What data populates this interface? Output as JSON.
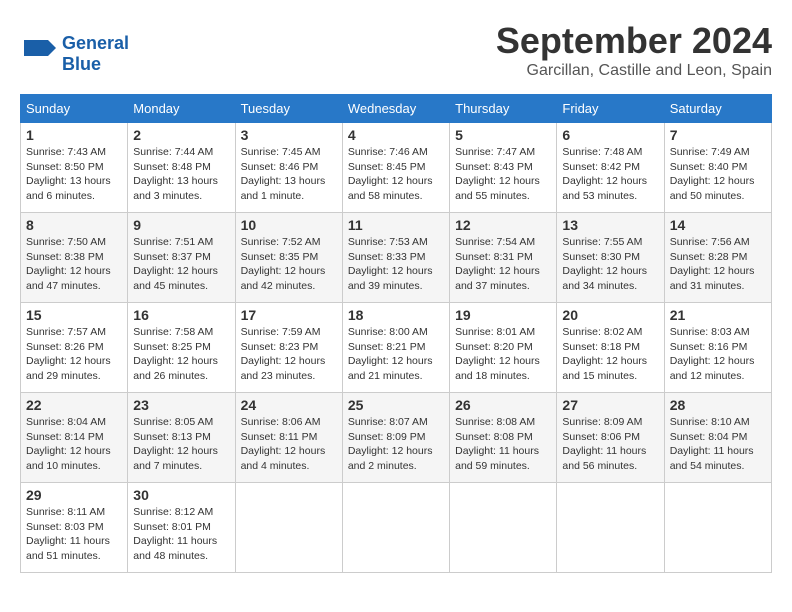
{
  "logo": {
    "line1": "General",
    "line2": "Blue"
  },
  "title": "September 2024",
  "location": "Garcillan, Castille and Leon, Spain",
  "headers": [
    "Sunday",
    "Monday",
    "Tuesday",
    "Wednesday",
    "Thursday",
    "Friday",
    "Saturday"
  ],
  "weeks": [
    [
      {
        "day": "1",
        "info": "Sunrise: 7:43 AM\nSunset: 8:50 PM\nDaylight: 13 hours\nand 6 minutes."
      },
      {
        "day": "2",
        "info": "Sunrise: 7:44 AM\nSunset: 8:48 PM\nDaylight: 13 hours\nand 3 minutes."
      },
      {
        "day": "3",
        "info": "Sunrise: 7:45 AM\nSunset: 8:46 PM\nDaylight: 13 hours\nand 1 minute."
      },
      {
        "day": "4",
        "info": "Sunrise: 7:46 AM\nSunset: 8:45 PM\nDaylight: 12 hours\nand 58 minutes."
      },
      {
        "day": "5",
        "info": "Sunrise: 7:47 AM\nSunset: 8:43 PM\nDaylight: 12 hours\nand 55 minutes."
      },
      {
        "day": "6",
        "info": "Sunrise: 7:48 AM\nSunset: 8:42 PM\nDaylight: 12 hours\nand 53 minutes."
      },
      {
        "day": "7",
        "info": "Sunrise: 7:49 AM\nSunset: 8:40 PM\nDaylight: 12 hours\nand 50 minutes."
      }
    ],
    [
      {
        "day": "8",
        "info": "Sunrise: 7:50 AM\nSunset: 8:38 PM\nDaylight: 12 hours\nand 47 minutes."
      },
      {
        "day": "9",
        "info": "Sunrise: 7:51 AM\nSunset: 8:37 PM\nDaylight: 12 hours\nand 45 minutes."
      },
      {
        "day": "10",
        "info": "Sunrise: 7:52 AM\nSunset: 8:35 PM\nDaylight: 12 hours\nand 42 minutes."
      },
      {
        "day": "11",
        "info": "Sunrise: 7:53 AM\nSunset: 8:33 PM\nDaylight: 12 hours\nand 39 minutes."
      },
      {
        "day": "12",
        "info": "Sunrise: 7:54 AM\nSunset: 8:31 PM\nDaylight: 12 hours\nand 37 minutes."
      },
      {
        "day": "13",
        "info": "Sunrise: 7:55 AM\nSunset: 8:30 PM\nDaylight: 12 hours\nand 34 minutes."
      },
      {
        "day": "14",
        "info": "Sunrise: 7:56 AM\nSunset: 8:28 PM\nDaylight: 12 hours\nand 31 minutes."
      }
    ],
    [
      {
        "day": "15",
        "info": "Sunrise: 7:57 AM\nSunset: 8:26 PM\nDaylight: 12 hours\nand 29 minutes."
      },
      {
        "day": "16",
        "info": "Sunrise: 7:58 AM\nSunset: 8:25 PM\nDaylight: 12 hours\nand 26 minutes."
      },
      {
        "day": "17",
        "info": "Sunrise: 7:59 AM\nSunset: 8:23 PM\nDaylight: 12 hours\nand 23 minutes."
      },
      {
        "day": "18",
        "info": "Sunrise: 8:00 AM\nSunset: 8:21 PM\nDaylight: 12 hours\nand 21 minutes."
      },
      {
        "day": "19",
        "info": "Sunrise: 8:01 AM\nSunset: 8:20 PM\nDaylight: 12 hours\nand 18 minutes."
      },
      {
        "day": "20",
        "info": "Sunrise: 8:02 AM\nSunset: 8:18 PM\nDaylight: 12 hours\nand 15 minutes."
      },
      {
        "day": "21",
        "info": "Sunrise: 8:03 AM\nSunset: 8:16 PM\nDaylight: 12 hours\nand 12 minutes."
      }
    ],
    [
      {
        "day": "22",
        "info": "Sunrise: 8:04 AM\nSunset: 8:14 PM\nDaylight: 12 hours\nand 10 minutes."
      },
      {
        "day": "23",
        "info": "Sunrise: 8:05 AM\nSunset: 8:13 PM\nDaylight: 12 hours\nand 7 minutes."
      },
      {
        "day": "24",
        "info": "Sunrise: 8:06 AM\nSunset: 8:11 PM\nDaylight: 12 hours\nand 4 minutes."
      },
      {
        "day": "25",
        "info": "Sunrise: 8:07 AM\nSunset: 8:09 PM\nDaylight: 12 hours\nand 2 minutes."
      },
      {
        "day": "26",
        "info": "Sunrise: 8:08 AM\nSunset: 8:08 PM\nDaylight: 11 hours\nand 59 minutes."
      },
      {
        "day": "27",
        "info": "Sunrise: 8:09 AM\nSunset: 8:06 PM\nDaylight: 11 hours\nand 56 minutes."
      },
      {
        "day": "28",
        "info": "Sunrise: 8:10 AM\nSunset: 8:04 PM\nDaylight: 11 hours\nand 54 minutes."
      }
    ],
    [
      {
        "day": "29",
        "info": "Sunrise: 8:11 AM\nSunset: 8:03 PM\nDaylight: 11 hours\nand 51 minutes."
      },
      {
        "day": "30",
        "info": "Sunrise: 8:12 AM\nSunset: 8:01 PM\nDaylight: 11 hours\nand 48 minutes."
      },
      null,
      null,
      null,
      null,
      null
    ]
  ]
}
